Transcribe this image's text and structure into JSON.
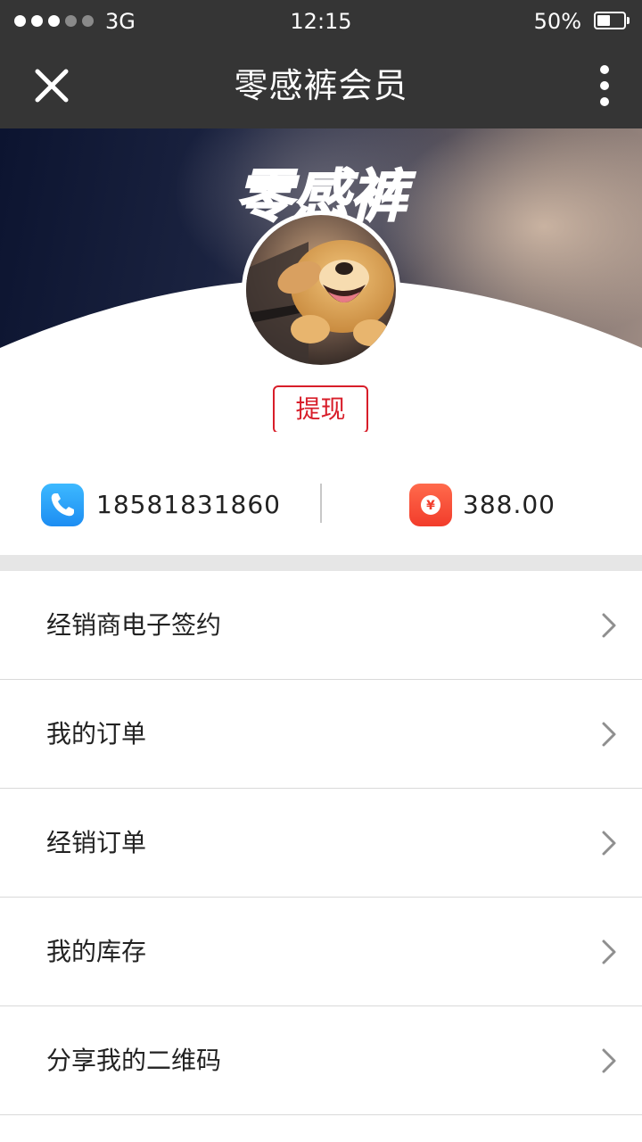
{
  "status_bar": {
    "network": "3G",
    "time": "12:15",
    "battery_text": "50%",
    "battery_level": 0.5,
    "signal_icon": "signal-dots-icon",
    "battery_icon": "battery-icon"
  },
  "nav": {
    "title": "零感裤会员",
    "close_icon": "close-icon",
    "more_icon": "more-vertical-icon"
  },
  "hero": {
    "logo_text": "零感裤",
    "avatar_icon": "dog-avatar"
  },
  "withdraw": {
    "label": "提现",
    "color": "#d81e2a"
  },
  "info": {
    "phone": "18581831860",
    "phone_icon": "phone-icon",
    "phone_icon_color": "#1d8df2",
    "balance": "388.00",
    "balance_icon": "yuan-coin-icon",
    "balance_icon_color": "#f23c2b",
    "currency_symbol": "¥"
  },
  "menu": {
    "items": [
      {
        "label": "经销商电子签约",
        "icon": "chevron-right-icon"
      },
      {
        "label": "我的订单",
        "icon": "chevron-right-icon"
      },
      {
        "label": "经销订单",
        "icon": "chevron-right-icon"
      },
      {
        "label": "我的库存",
        "icon": "chevron-right-icon"
      },
      {
        "label": "分享我的二维码",
        "icon": "chevron-right-icon"
      }
    ]
  },
  "colors": {
    "bar_background": "#353535",
    "accent_red": "#d81e2a",
    "divider": "#d9d9d9"
  }
}
